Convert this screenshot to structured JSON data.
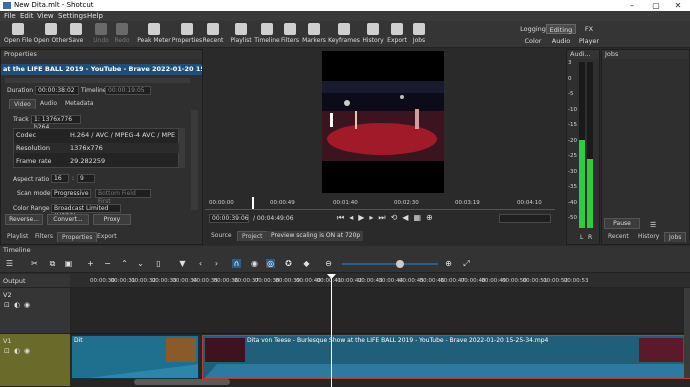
{
  "window": {
    "title": "New Dita.mlt - Shotcut"
  },
  "menu": [
    "File",
    "Edit",
    "View",
    "Settings",
    "Help"
  ],
  "toolbar": [
    {
      "label": "Open File",
      "icon": "open-file-icon",
      "enabled": true
    },
    {
      "label": "Open Other",
      "icon": "open-other-icon",
      "enabled": true
    },
    {
      "label": "Save",
      "icon": "save-icon",
      "enabled": true
    },
    {
      "label": "Undo",
      "icon": "undo-icon",
      "enabled": false
    },
    {
      "label": "Redo",
      "icon": "redo-icon",
      "enabled": false
    },
    {
      "label": "Peak Meter",
      "icon": "peak-meter-icon",
      "enabled": true
    },
    {
      "label": "Properties",
      "icon": "properties-icon",
      "enabled": true
    },
    {
      "label": "Recent",
      "icon": "recent-icon",
      "enabled": true
    },
    {
      "label": "Playlist",
      "icon": "playlist-icon",
      "enabled": true
    },
    {
      "label": "Timeline",
      "icon": "timeline-icon",
      "enabled": true
    },
    {
      "label": "Filters",
      "icon": "filters-icon",
      "enabled": true
    },
    {
      "label": "Markers",
      "icon": "markers-icon",
      "enabled": true
    },
    {
      "label": "Keyframes",
      "icon": "keyframes-icon",
      "enabled": true
    },
    {
      "label": "History",
      "icon": "history-icon",
      "enabled": true
    },
    {
      "label": "Export",
      "icon": "export-icon",
      "enabled": true
    },
    {
      "label": "Jobs",
      "icon": "jobs-icon",
      "enabled": true
    }
  ],
  "layouts": {
    "top": [
      "Logging",
      "Editing",
      "FX"
    ],
    "bottom": [
      "Color",
      "Audio",
      "Player"
    ],
    "active": "Editing"
  },
  "properties": {
    "title": "Properties",
    "clip_name": "at the LIFE BALL 2019 - YouTube - Brave 2022-01-20 15-25-34.mp4",
    "duration_label": "Duration",
    "duration": "00:00:38:02",
    "timeline_label": "Timeline",
    "timeline": "00:00:19:05",
    "tabs": [
      "Video",
      "Audio",
      "Metadata"
    ],
    "active_tab": "Video",
    "track_label": "Track",
    "track": "1: 1376x776 h264",
    "info": [
      {
        "key": "Codec",
        "value": "H.264 / AVC / MPEG-4 AVC / MPEG-..."
      },
      {
        "key": "Resolution",
        "value": "1376x776"
      },
      {
        "key": "Frame rate",
        "value": "29.282259"
      }
    ],
    "aspect_label": "Aspect ratio",
    "aspect_w": "16",
    "aspect_h": "9",
    "scan_label": "Scan mode",
    "scan_mode": "Progressive",
    "field_order": "Bottom Field First",
    "color_range_label": "Color Range",
    "color_range": "Broadcast Limited (MPEG)",
    "buttons": [
      "Reverse...",
      "Convert...",
      "Proxy"
    ],
    "bottom_tabs": [
      "Playlist",
      "Filters",
      "Properties",
      "Export"
    ]
  },
  "player": {
    "ruler_ticks": [
      "00:00:00",
      "00:00:49",
      "00:01:40",
      "00:02:30",
      "00:03:19",
      "00:04:10"
    ],
    "current_time": "00:00:39:06",
    "total_time": "/ 00:04:49:06",
    "tabs": [
      "Source",
      "Project"
    ],
    "status": "Preview scaling is ON at 720p",
    "current_position": 0.135
  },
  "audio": {
    "title": "Audi...",
    "scale": [
      "3",
      "0",
      "-5",
      "-10",
      "-15",
      "-20",
      "-25",
      "-30",
      "-35",
      "-40",
      "-50"
    ],
    "channels": [
      "L",
      "R"
    ],
    "level_l": -22,
    "level_r": -28
  },
  "jobs": {
    "title": "Jobs",
    "pause_label": "Pause",
    "tabs": [
      "Recent",
      "History",
      "Jobs"
    ]
  },
  "timeline": {
    "title": "Timeline",
    "ruler_ticks": [
      "00:00:30",
      "00:00:31",
      "00:00:32",
      "00:00:33",
      "00:00:34",
      "00:00:35",
      "00:00:36",
      "00:00:37",
      "00:00:38",
      "00:00:39",
      "00:00:40",
      "00:00:41",
      "00:00:42",
      "00:00:43",
      "00:00:44",
      "00:00:45",
      "00:00:46",
      "00:00:47",
      "00:00:48",
      "00:00:49",
      "00:00:50",
      "00:00:51",
      "00:00:52",
      "00:00:53"
    ],
    "tracks": [
      "Output",
      "V2",
      "V1"
    ],
    "clips": [
      {
        "label": "Dit",
        "selected": false
      },
      {
        "label": "Dita von Teese - Burlesque Show at the LIFE BALL 2019 - YouTube - Brave 2022-01-20 15-25-34.mp4",
        "selected": true
      }
    ]
  },
  "colors": {
    "accent": "#2b5c8a",
    "clip": "#1f5f7a",
    "selected_border": "#c0392b",
    "meter_green": "#2ecc40",
    "meter_red": "#e74c3c"
  }
}
